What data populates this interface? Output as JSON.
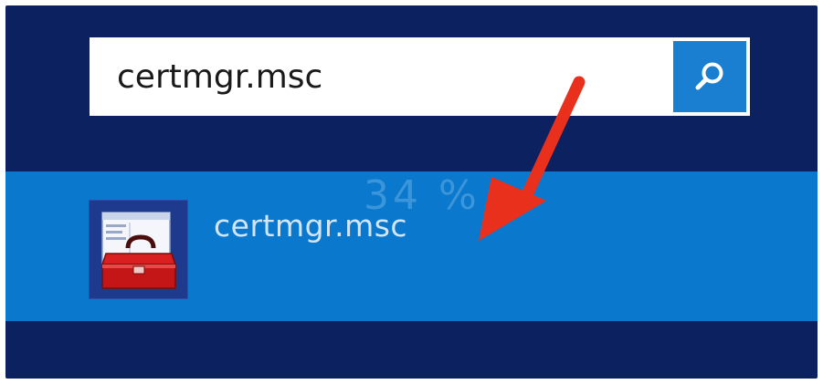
{
  "search": {
    "query": "certmgr.msc",
    "button_icon": "search-icon",
    "accent_color": "#1a7fd0"
  },
  "results": [
    {
      "label": "certmgr.msc",
      "icon": "toolbox-icon",
      "highlight_color": "#0a78cc"
    }
  ],
  "progress_overlay": {
    "text": "34 %"
  },
  "annotation": {
    "icon": "red-arrow-icon",
    "color": "#e8301c"
  },
  "background_color": "#0b2160"
}
